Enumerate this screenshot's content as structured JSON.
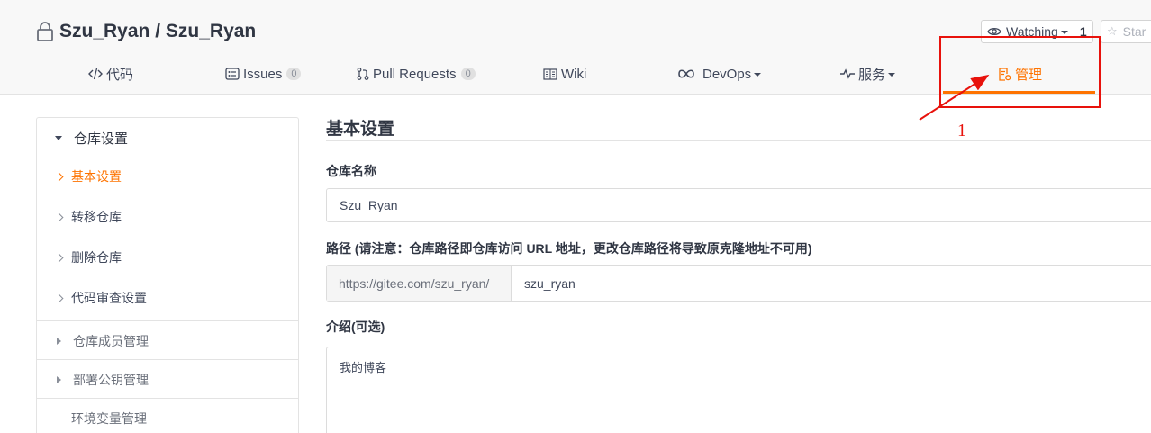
{
  "repo": {
    "owner": "Szu_Ryan",
    "separator": " / ",
    "name": "Szu_Ryan"
  },
  "actions": {
    "watch_label": "Watching",
    "watch_count": "1",
    "star_label": "Star"
  },
  "nav": {
    "code": "代码",
    "issues": "Issues",
    "issues_count": "0",
    "pull_requests": "Pull Requests",
    "pull_requests_count": "0",
    "wiki": "Wiki",
    "devops": "DevOps",
    "services": "服务",
    "manage": "管理"
  },
  "annotation": {
    "number": "1",
    "color": "#e8120c"
  },
  "sidebar": {
    "section_title": "仓库设置",
    "items": [
      {
        "label": "基本设置",
        "active": true
      },
      {
        "label": "转移仓库"
      },
      {
        "label": "删除仓库"
      },
      {
        "label": "代码审查设置"
      }
    ],
    "groups": [
      {
        "label": "仓库成员管理"
      },
      {
        "label": "部署公钥管理"
      },
      {
        "label": "环境变量管理"
      }
    ]
  },
  "main": {
    "title": "基本设置",
    "repo_name_label": "仓库名称",
    "repo_name_value": "Szu_Ryan",
    "path_label": "路径 (请注意：仓库路径即仓库访问 URL 地址，更改仓库路径将导致原克隆地址不可用)",
    "path_prefix": "https://gitee.com/szu_ryan/",
    "path_value": "szu_ryan",
    "intro_label": "介绍(可选)",
    "intro_value": "我的博客"
  },
  "colors": {
    "accent": "#fe7300",
    "annotation": "#e8120c"
  }
}
